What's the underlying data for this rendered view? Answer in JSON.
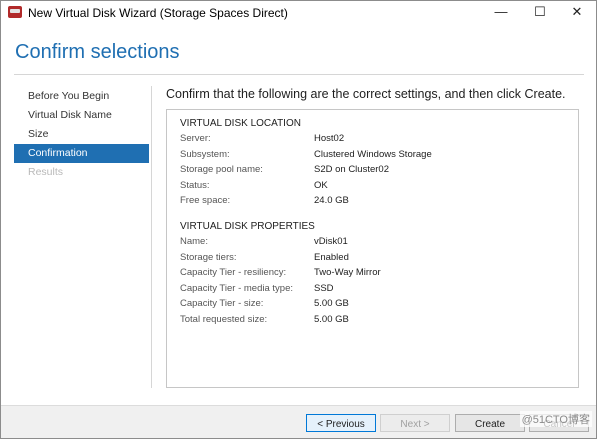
{
  "window": {
    "title": "New Virtual Disk Wizard (Storage Spaces Direct)",
    "controls": {
      "minimize": "—",
      "maximize": "☐",
      "close": "✕"
    }
  },
  "header": {
    "title": "Confirm selections"
  },
  "nav": {
    "items": [
      {
        "label": "Before You Begin",
        "state": "normal"
      },
      {
        "label": "Virtual Disk Name",
        "state": "normal"
      },
      {
        "label": "Size",
        "state": "normal"
      },
      {
        "label": "Confirmation",
        "state": "active"
      },
      {
        "label": "Results",
        "state": "disabled"
      }
    ]
  },
  "main": {
    "heading": "Confirm that the following are the correct settings, and then click Create.",
    "location": {
      "title": "VIRTUAL DISK LOCATION",
      "rows": [
        {
          "label": "Server:",
          "value": "Host02"
        },
        {
          "label": "Subsystem:",
          "value": "Clustered Windows Storage"
        },
        {
          "label": "Storage pool name:",
          "value": "S2D on Cluster02"
        },
        {
          "label": "Status:",
          "value": "OK"
        },
        {
          "label": "Free space:",
          "value": "24.0 GB"
        }
      ]
    },
    "properties": {
      "title": "VIRTUAL DISK PROPERTIES",
      "rows": [
        {
          "label": "Name:",
          "value": "vDisk01"
        },
        {
          "label": "Storage tiers:",
          "value": "Enabled"
        },
        {
          "label": "Capacity Tier - resiliency:",
          "value": "Two-Way Mirror"
        },
        {
          "label": "Capacity Tier - media type:",
          "value": "SSD"
        },
        {
          "label": "Capacity Tier - size:",
          "value": "5.00 GB"
        },
        {
          "label": "Total requested size:",
          "value": "5.00 GB"
        }
      ]
    }
  },
  "footer": {
    "previous": "< Previous",
    "next": "Next >",
    "create": "Create",
    "cancel": "Cancel"
  },
  "watermark": "@51CTO博客",
  "colors": {
    "accent": "#1f6fb2",
    "active_nav_bg": "#1f6fb2",
    "app_icon": "#b12a2a"
  }
}
